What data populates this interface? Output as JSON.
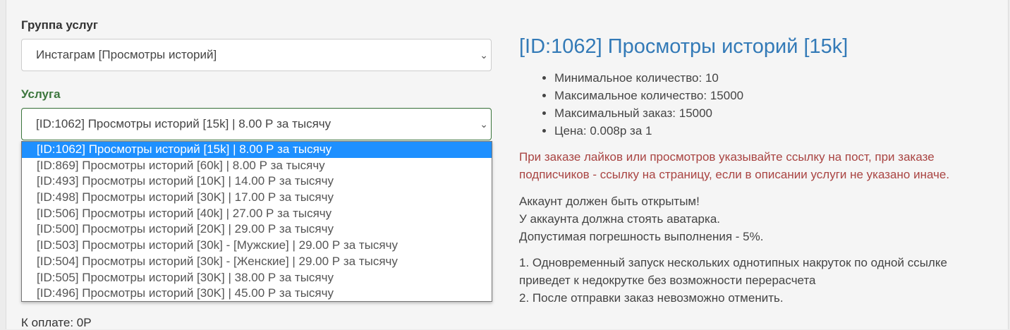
{
  "form": {
    "group_label": "Группа услуг",
    "group_value": "Инстаграм [Просмотры историй]",
    "service_label": "Услуга",
    "service_value": "[ID:1062] Просмотры историй [15k] | 8.00 Р за тысячу",
    "options": [
      "[ID:1062] Просмотры историй [15k] | 8.00 Р за тысячу",
      "[ID:869] Просмотры историй [60k] | 8.00 Р за тысячу",
      "[ID:493] Просмотры историй [10K] | 14.00 Р за тысячу",
      "[ID:498] Просмотры историй [30K] | 17.00 Р за тысячу",
      "[ID:506] Просмотры историй [40k] | 27.00 Р за тысячу",
      "[ID:500] Просмотры историй [20K] | 29.00 Р за тысячу",
      "[ID:503] Просмотры историй [30k] - [Мужские] | 29.00 Р за тысячу",
      "[ID:504] Просмотры историй [30k] - [Женские] | 29.00 Р за тысячу",
      "[ID:505] Просмотры историй [30K] | 38.00 Р за тысячу",
      "[ID:496] Просмотры историй [30K] | 45.00 Р за тысячу"
    ],
    "to_pay": "К оплате: 0Р"
  },
  "info": {
    "title": "[ID:1062] Просмотры историй [15k]",
    "specs": [
      "Минимальное количество: 10",
      "Максимальное количество: 15000",
      "Максимальный заказ: 15000",
      "Цена: 0.008р за 1"
    ],
    "warning": [
      "При заказе лайков или просмотров указывайте ссылку на пост, при заказе",
      "подписчиков - ссылку на страницу, если в описании услуги не указано иначе."
    ],
    "notes": [
      "Аккаунт должен быть открытым!",
      "У аккаунта должна стоять аватарка.",
      "Допустимая погрешность выполнения - 5%."
    ],
    "rules": [
      "1. Одновременный запуск нескольких однотипных накруток по одной ссылке",
      "приведет к недокрутке без возможности перерасчета",
      "2. После отправки заказ невозможно отменить."
    ]
  },
  "colors": {
    "accent": "#337ab7",
    "success": "#3c763d",
    "danger": "#a94442",
    "selected": "#1e90ff"
  }
}
